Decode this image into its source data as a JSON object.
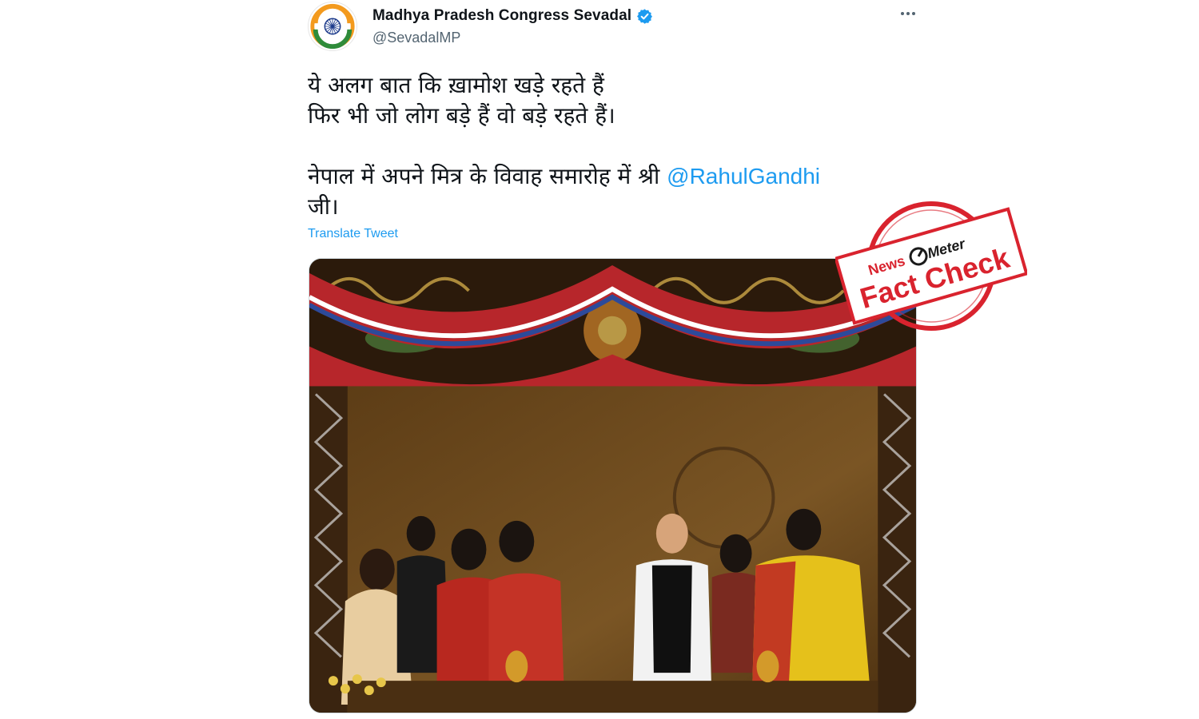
{
  "tweet": {
    "display_name": "Madhya Pradesh Congress Sevadal",
    "handle": "@SevadalMP",
    "text_line1": "ये अलग बात कि ख़ामोश खड़े रहते हैं",
    "text_line2": "फिर भी जो लोग बड़े हैं वो बड़े रहते हैं।",
    "text_line3": "नेपाल में अपने मित्र के विवाह समारोह में श्री ",
    "mention": "@RahulGandhi",
    "text_line4": "जी।",
    "translate_label": "Translate Tweet"
  },
  "stamp": {
    "brand_news": "News",
    "brand_meter": "Meter",
    "label": "Fact Check"
  },
  "icons": {
    "verified": "verified-badge-icon",
    "more": "more-options-icon",
    "logo": "sevadal-logo-icon"
  },
  "colors": {
    "link": "#1d9bf0",
    "text": "#0f1419",
    "secondary": "#536471",
    "stamp_red": "#d9232e"
  }
}
